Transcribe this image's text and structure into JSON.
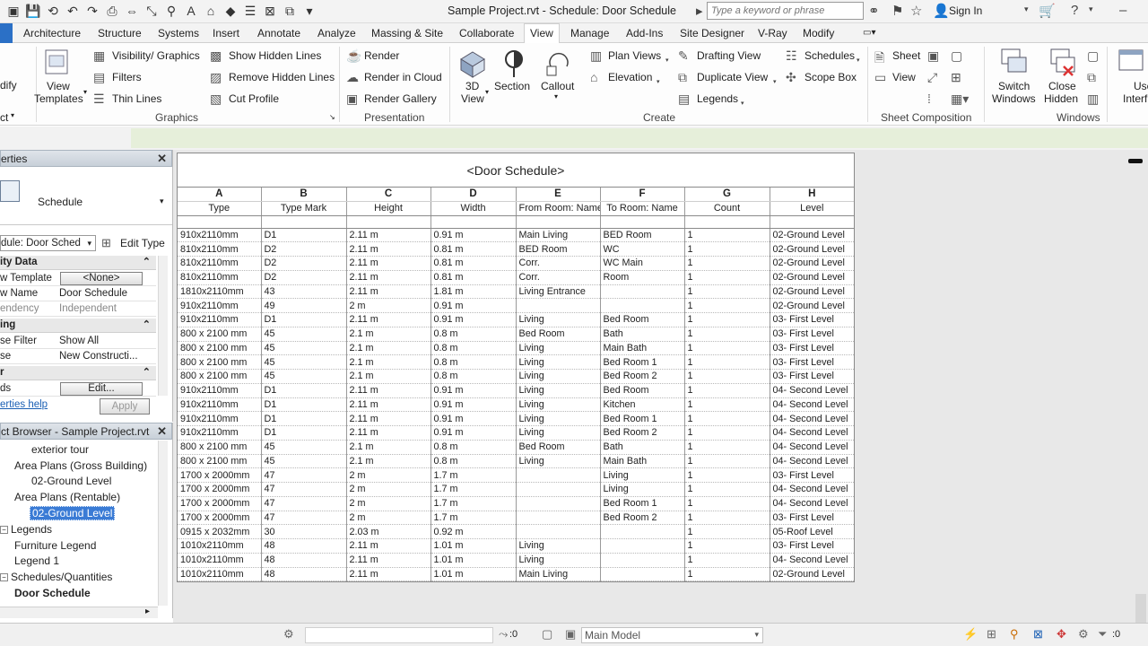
{
  "app": {
    "title": "Sample Project.rvt - Schedule: Door Schedule",
    "search_placeholder": "Type a keyword or phrase",
    "sign_in": "Sign In"
  },
  "tabs": [
    "Architecture",
    "Structure",
    "Systems",
    "Insert",
    "Annotate",
    "Analyze",
    "Massing & Site",
    "Collaborate",
    "View",
    "Manage",
    "Add-Ins",
    "Site Designer",
    "V-Ray",
    "Modify"
  ],
  "active_tab": "View",
  "ribbon": {
    "modify_partial": "dify",
    "select_partial": "ct",
    "view_templates": [
      "View",
      "Templates"
    ],
    "graphics": {
      "visibility": "Visibility/ Graphics",
      "filters": "Filters",
      "thin_lines": "Thin Lines",
      "show_hidden": "Show  Hidden Lines",
      "remove_hidden": "Remove  Hidden Lines",
      "cut_profile": "Cut  Profile",
      "label": "Graphics"
    },
    "presentation": {
      "render": "Render",
      "render_cloud": "Render  in Cloud",
      "render_gallery": "Render  Gallery",
      "label": "Presentation"
    },
    "create": {
      "view3d": [
        "3D",
        "View"
      ],
      "section": "Section",
      "callout": "Callout",
      "plan_views": "Plan  Views",
      "elevation": "Elevation",
      "drafting_view": "Drafting  View",
      "duplicate_view": "Duplicate  View",
      "legends": "Legends",
      "schedules": "Schedules",
      "scope_box": "Scope  Box",
      "label": "Create"
    },
    "sheet_composition": {
      "sheet": "Sheet",
      "view": "View",
      "label": "Sheet Composition"
    },
    "windows": {
      "switch": [
        "Switch",
        "Windows"
      ],
      "close_hidden": [
        "Close",
        "Hidden"
      ],
      "user_partial": [
        "Use",
        "Interf"
      ],
      "label": "Windows"
    }
  },
  "properties": {
    "title_partial": "erties",
    "type_name": "Schedule",
    "instance_selector": "dule: Door Sched",
    "edit_type": "Edit Type",
    "groups": [
      {
        "name": "ity Data",
        "rows": [
          {
            "key": "w Template",
            "value": "<None>",
            "button": true
          },
          {
            "key": "w Name",
            "value": "Door Schedule"
          },
          {
            "key": "endency",
            "value": "Independent",
            "disabled": true
          }
        ]
      },
      {
        "name": "ing",
        "rows": [
          {
            "key": "se Filter",
            "value": "Show All"
          },
          {
            "key": "se",
            "value": "New Constructi..."
          }
        ]
      },
      {
        "name": "r",
        "rows": [
          {
            "key": "ds",
            "value": "Edit...",
            "button": true
          }
        ]
      }
    ],
    "help": "erties help",
    "apply": "Apply"
  },
  "project_browser": {
    "title": "ct Browser - Sample Project.rvt",
    "items": [
      {
        "label": "exterior tour",
        "indent": 2
      },
      {
        "label": "Area Plans (Gross Building)",
        "indent": 1
      },
      {
        "label": "02-Ground Level",
        "indent": 2
      },
      {
        "label": "Area Plans (Rentable)",
        "indent": 1
      },
      {
        "label": "02-Ground Level",
        "indent": 2,
        "selected": true
      },
      {
        "label": "Legends",
        "indent": 0
      },
      {
        "label": "Furniture Legend",
        "indent": 1
      },
      {
        "label": "Legend 1",
        "indent": 1
      },
      {
        "label": "Schedules/Quantities",
        "indent": 0
      },
      {
        "label": "Door Schedule",
        "indent": 1,
        "bold": true
      }
    ]
  },
  "schedule": {
    "title": "<Door Schedule>",
    "letters": [
      "A",
      "B",
      "C",
      "D",
      "E",
      "F",
      "G",
      "H"
    ],
    "headers": [
      "Type",
      "Type Mark",
      "Height",
      "Width",
      "From Room: Name",
      "To Room: Name",
      "Count",
      "Level"
    ],
    "rows": [
      [
        "910x2110mm",
        "D1",
        "2.11 m",
        "0.91 m",
        "Main Living",
        "BED Room",
        "1",
        "02-Ground Level"
      ],
      [
        "810x2110mm",
        "D2",
        "2.11 m",
        "0.81 m",
        "BED Room",
        "WC",
        "1",
        "02-Ground Level"
      ],
      [
        "810x2110mm",
        "D2",
        "2.11 m",
        "0.81 m",
        "Corr.",
        "WC Main",
        "1",
        "02-Ground Level"
      ],
      [
        "810x2110mm",
        "D2",
        "2.11 m",
        "0.81 m",
        "Corr.",
        "Room",
        "1",
        "02-Ground Level"
      ],
      [
        "1810x2110mm",
        "43",
        "2.11 m",
        "1.81 m",
        "Living Entrance",
        "",
        "1",
        "02-Ground Level"
      ],
      [
        "910x2110mm",
        "49",
        "2 m",
        "0.91 m",
        "",
        "",
        "1",
        "02-Ground Level"
      ],
      [
        "910x2110mm",
        "D1",
        "2.11 m",
        "0.91 m",
        "Living",
        "Bed Room",
        "1",
        "03- First Level"
      ],
      [
        "800 x 2100 mm",
        "45",
        "2.1 m",
        "0.8 m",
        "Bed Room",
        "Bath",
        "1",
        "03- First Level"
      ],
      [
        "800 x 2100 mm",
        "45",
        "2.1 m",
        "0.8 m",
        "Living",
        "Main Bath",
        "1",
        "03- First Level"
      ],
      [
        "800 x 2100 mm",
        "45",
        "2.1 m",
        "0.8 m",
        "Living",
        "Bed Room 1",
        "1",
        "03- First Level"
      ],
      [
        "800 x 2100 mm",
        "45",
        "2.1 m",
        "0.8 m",
        "Living",
        "Bed Room 2",
        "1",
        "03- First Level"
      ],
      [
        "910x2110mm",
        "D1",
        "2.11 m",
        "0.91 m",
        "Living",
        "Bed Room",
        "1",
        "04- Second Level"
      ],
      [
        "910x2110mm",
        "D1",
        "2.11 m",
        "0.91 m",
        "Living",
        "Kitchen",
        "1",
        "04- Second Level"
      ],
      [
        "910x2110mm",
        "D1",
        "2.11 m",
        "0.91 m",
        "Living",
        "Bed Room 1",
        "1",
        "04- Second Level"
      ],
      [
        "910x2110mm",
        "D1",
        "2.11 m",
        "0.91 m",
        "Living",
        "Bed Room 2",
        "1",
        "04- Second Level"
      ],
      [
        "800 x 2100 mm",
        "45",
        "2.1 m",
        "0.8 m",
        "Bed Room",
        "Bath",
        "1",
        "04- Second Level"
      ],
      [
        "800 x 2100 mm",
        "45",
        "2.1 m",
        "0.8 m",
        "Living",
        "Main Bath",
        "1",
        "04- Second Level"
      ],
      [
        "1700 x 2000mm",
        "47",
        "2 m",
        "1.7 m",
        "",
        "Living",
        "1",
        "03- First Level"
      ],
      [
        "1700 x 2000mm",
        "47",
        "2 m",
        "1.7 m",
        "",
        "Living",
        "1",
        "04- Second Level"
      ],
      [
        "1700 x 2000mm",
        "47",
        "2 m",
        "1.7 m",
        "",
        "Bed Room 1",
        "1",
        "04- Second Level"
      ],
      [
        "1700 x 2000mm",
        "47",
        "2 m",
        "1.7 m",
        "",
        "Bed Room 2",
        "1",
        "03- First Level"
      ],
      [
        "0915 x 2032mm",
        "30",
        "2.03 m",
        "0.92 m",
        "",
        "",
        "1",
        "05-Roof Level"
      ],
      [
        "1010x2110mm",
        "48",
        "2.11 m",
        "1.01 m",
        "Living",
        "",
        "1",
        "03- First Level"
      ],
      [
        "1010x2110mm",
        "48",
        "2.11 m",
        "1.01 m",
        "Living",
        "",
        "1",
        "04- Second Level"
      ],
      [
        "1010x2110mm",
        "48",
        "2.11 m",
        "1.01 m",
        "Main Living",
        "",
        "1",
        "02-Ground Level"
      ]
    ]
  },
  "status": {
    "selection_count": ":0",
    "model": "Main Model",
    "filter_count": ":0"
  }
}
